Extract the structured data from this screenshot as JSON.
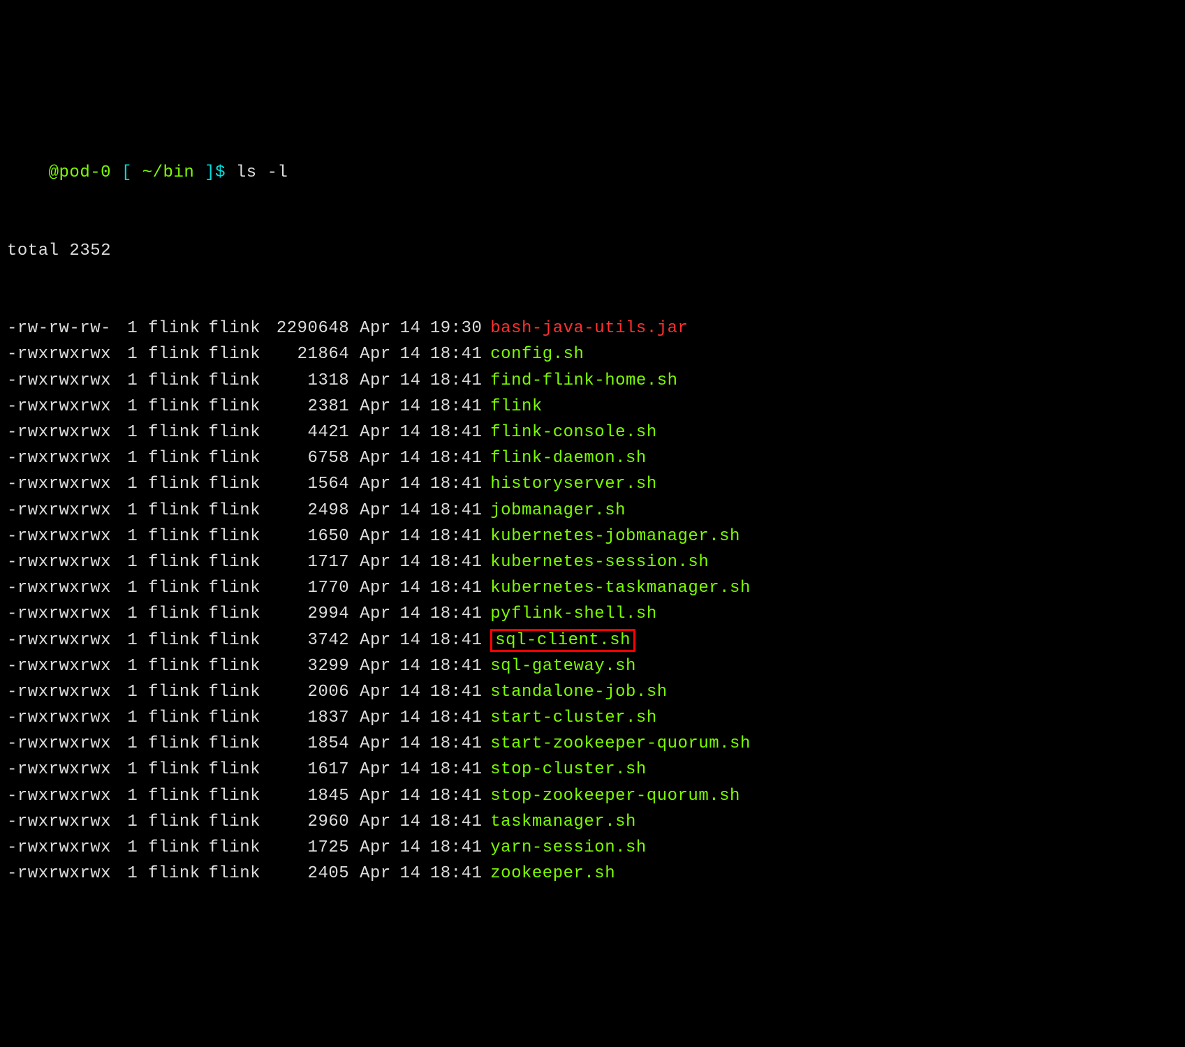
{
  "prompt": {
    "host": "@pod-0",
    "bracket_open": "[",
    "cwd": "~/bin",
    "bracket_close": "]$",
    "command": "ls -l"
  },
  "total_line": "total 2352",
  "files": [
    {
      "perm": "-rw-rw-rw-",
      "n": "1",
      "own": "flink",
      "grp": "flink",
      "sz": "2290648",
      "mo": "Apr",
      "dy": "14",
      "tm": "19:30",
      "name": "bash-java-utils.jar",
      "kind": "red",
      "hl": false
    },
    {
      "perm": "-rwxrwxrwx",
      "n": "1",
      "own": "flink",
      "grp": "flink",
      "sz": "21864",
      "mo": "Apr",
      "dy": "14",
      "tm": "18:41",
      "name": "config.sh",
      "kind": "green",
      "hl": false
    },
    {
      "perm": "-rwxrwxrwx",
      "n": "1",
      "own": "flink",
      "grp": "flink",
      "sz": "1318",
      "mo": "Apr",
      "dy": "14",
      "tm": "18:41",
      "name": "find-flink-home.sh",
      "kind": "green",
      "hl": false
    },
    {
      "perm": "-rwxrwxrwx",
      "n": "1",
      "own": "flink",
      "grp": "flink",
      "sz": "2381",
      "mo": "Apr",
      "dy": "14",
      "tm": "18:41",
      "name": "flink",
      "kind": "green",
      "hl": false
    },
    {
      "perm": "-rwxrwxrwx",
      "n": "1",
      "own": "flink",
      "grp": "flink",
      "sz": "4421",
      "mo": "Apr",
      "dy": "14",
      "tm": "18:41",
      "name": "flink-console.sh",
      "kind": "green",
      "hl": false
    },
    {
      "perm": "-rwxrwxrwx",
      "n": "1",
      "own": "flink",
      "grp": "flink",
      "sz": "6758",
      "mo": "Apr",
      "dy": "14",
      "tm": "18:41",
      "name": "flink-daemon.sh",
      "kind": "green",
      "hl": false
    },
    {
      "perm": "-rwxrwxrwx",
      "n": "1",
      "own": "flink",
      "grp": "flink",
      "sz": "1564",
      "mo": "Apr",
      "dy": "14",
      "tm": "18:41",
      "name": "historyserver.sh",
      "kind": "green",
      "hl": false
    },
    {
      "perm": "-rwxrwxrwx",
      "n": "1",
      "own": "flink",
      "grp": "flink",
      "sz": "2498",
      "mo": "Apr",
      "dy": "14",
      "tm": "18:41",
      "name": "jobmanager.sh",
      "kind": "green",
      "hl": false
    },
    {
      "perm": "-rwxrwxrwx",
      "n": "1",
      "own": "flink",
      "grp": "flink",
      "sz": "1650",
      "mo": "Apr",
      "dy": "14",
      "tm": "18:41",
      "name": "kubernetes-jobmanager.sh",
      "kind": "green",
      "hl": false
    },
    {
      "perm": "-rwxrwxrwx",
      "n": "1",
      "own": "flink",
      "grp": "flink",
      "sz": "1717",
      "mo": "Apr",
      "dy": "14",
      "tm": "18:41",
      "name": "kubernetes-session.sh",
      "kind": "green",
      "hl": false
    },
    {
      "perm": "-rwxrwxrwx",
      "n": "1",
      "own": "flink",
      "grp": "flink",
      "sz": "1770",
      "mo": "Apr",
      "dy": "14",
      "tm": "18:41",
      "name": "kubernetes-taskmanager.sh",
      "kind": "green",
      "hl": false
    },
    {
      "perm": "-rwxrwxrwx",
      "n": "1",
      "own": "flink",
      "grp": "flink",
      "sz": "2994",
      "mo": "Apr",
      "dy": "14",
      "tm": "18:41",
      "name": "pyflink-shell.sh",
      "kind": "green",
      "hl": false
    },
    {
      "perm": "-rwxrwxrwx",
      "n": "1",
      "own": "flink",
      "grp": "flink",
      "sz": "3742",
      "mo": "Apr",
      "dy": "14",
      "tm": "18:41",
      "name": "sql-client.sh",
      "kind": "green",
      "hl": true
    },
    {
      "perm": "-rwxrwxrwx",
      "n": "1",
      "own": "flink",
      "grp": "flink",
      "sz": "3299",
      "mo": "Apr",
      "dy": "14",
      "tm": "18:41",
      "name": "sql-gateway.sh",
      "kind": "green",
      "hl": false
    },
    {
      "perm": "-rwxrwxrwx",
      "n": "1",
      "own": "flink",
      "grp": "flink",
      "sz": "2006",
      "mo": "Apr",
      "dy": "14",
      "tm": "18:41",
      "name": "standalone-job.sh",
      "kind": "green",
      "hl": false
    },
    {
      "perm": "-rwxrwxrwx",
      "n": "1",
      "own": "flink",
      "grp": "flink",
      "sz": "1837",
      "mo": "Apr",
      "dy": "14",
      "tm": "18:41",
      "name": "start-cluster.sh",
      "kind": "green",
      "hl": false
    },
    {
      "perm": "-rwxrwxrwx",
      "n": "1",
      "own": "flink",
      "grp": "flink",
      "sz": "1854",
      "mo": "Apr",
      "dy": "14",
      "tm": "18:41",
      "name": "start-zookeeper-quorum.sh",
      "kind": "green",
      "hl": false
    },
    {
      "perm": "-rwxrwxrwx",
      "n": "1",
      "own": "flink",
      "grp": "flink",
      "sz": "1617",
      "mo": "Apr",
      "dy": "14",
      "tm": "18:41",
      "name": "stop-cluster.sh",
      "kind": "green",
      "hl": false
    },
    {
      "perm": "-rwxrwxrwx",
      "n": "1",
      "own": "flink",
      "grp": "flink",
      "sz": "1845",
      "mo": "Apr",
      "dy": "14",
      "tm": "18:41",
      "name": "stop-zookeeper-quorum.sh",
      "kind": "green",
      "hl": false
    },
    {
      "perm": "-rwxrwxrwx",
      "n": "1",
      "own": "flink",
      "grp": "flink",
      "sz": "2960",
      "mo": "Apr",
      "dy": "14",
      "tm": "18:41",
      "name": "taskmanager.sh",
      "kind": "green",
      "hl": false
    },
    {
      "perm": "-rwxrwxrwx",
      "n": "1",
      "own": "flink",
      "grp": "flink",
      "sz": "1725",
      "mo": "Apr",
      "dy": "14",
      "tm": "18:41",
      "name": "yarn-session.sh",
      "kind": "green",
      "hl": false
    },
    {
      "perm": "-rwxrwxrwx",
      "n": "1",
      "own": "flink",
      "grp": "flink",
      "sz": "2405",
      "mo": "Apr",
      "dy": "14",
      "tm": "18:41",
      "name": "zookeeper.sh",
      "kind": "green",
      "hl": false
    }
  ]
}
